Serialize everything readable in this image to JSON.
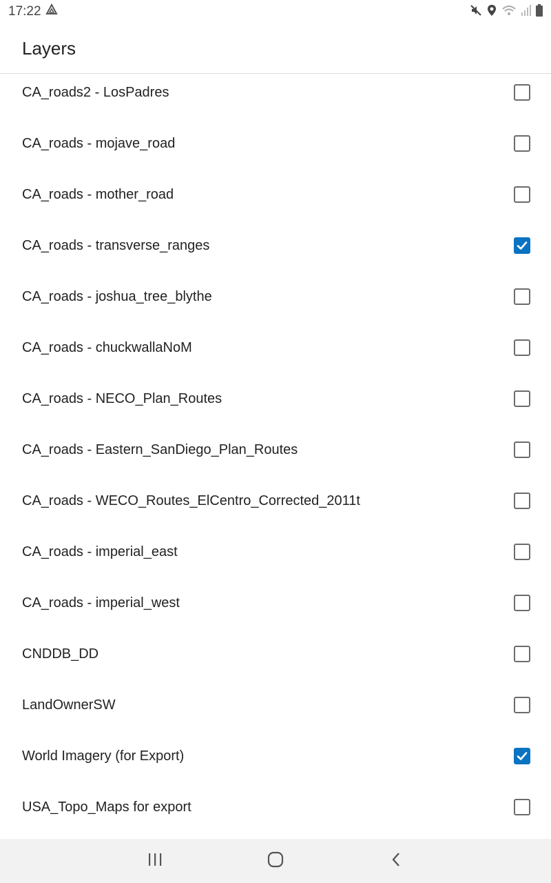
{
  "status_bar": {
    "time": "17:22",
    "icons": [
      "drive-icon",
      "mute-icon",
      "location-icon",
      "wifi-icon",
      "signal-icon",
      "battery-icon"
    ]
  },
  "header": {
    "title": "Layers"
  },
  "layers": [
    {
      "label": "CA_roads2 - LosPadres",
      "checked": false
    },
    {
      "label": "CA_roads - mojave_road",
      "checked": false
    },
    {
      "label": "CA_roads - mother_road",
      "checked": false
    },
    {
      "label": "CA_roads - transverse_ranges",
      "checked": true
    },
    {
      "label": "CA_roads - joshua_tree_blythe",
      "checked": false
    },
    {
      "label": "CA_roads - chuckwallaNoM",
      "checked": false
    },
    {
      "label": "CA_roads - NECO_Plan_Routes",
      "checked": false
    },
    {
      "label": "CA_roads - Eastern_SanDiego_Plan_Routes",
      "checked": false
    },
    {
      "label": "CA_roads - WECO_Routes_ElCentro_Corrected_2011t",
      "checked": false
    },
    {
      "label": "CA_roads - imperial_east",
      "checked": false
    },
    {
      "label": "CA_roads - imperial_west",
      "checked": false
    },
    {
      "label": "CNDDB_DD",
      "checked": false
    },
    {
      "label": "LandOwnerSW",
      "checked": false
    },
    {
      "label": "World Imagery (for Export)",
      "checked": true
    },
    {
      "label": "USA_Topo_Maps for export",
      "checked": false
    }
  ],
  "nav_bar": {
    "icons": [
      "recent-apps-icon",
      "home-icon",
      "back-icon"
    ]
  },
  "colors": {
    "accent": "#0a73c2",
    "checkbox_border": "#6b6b6b",
    "nav_background": "#f2f2f2"
  }
}
